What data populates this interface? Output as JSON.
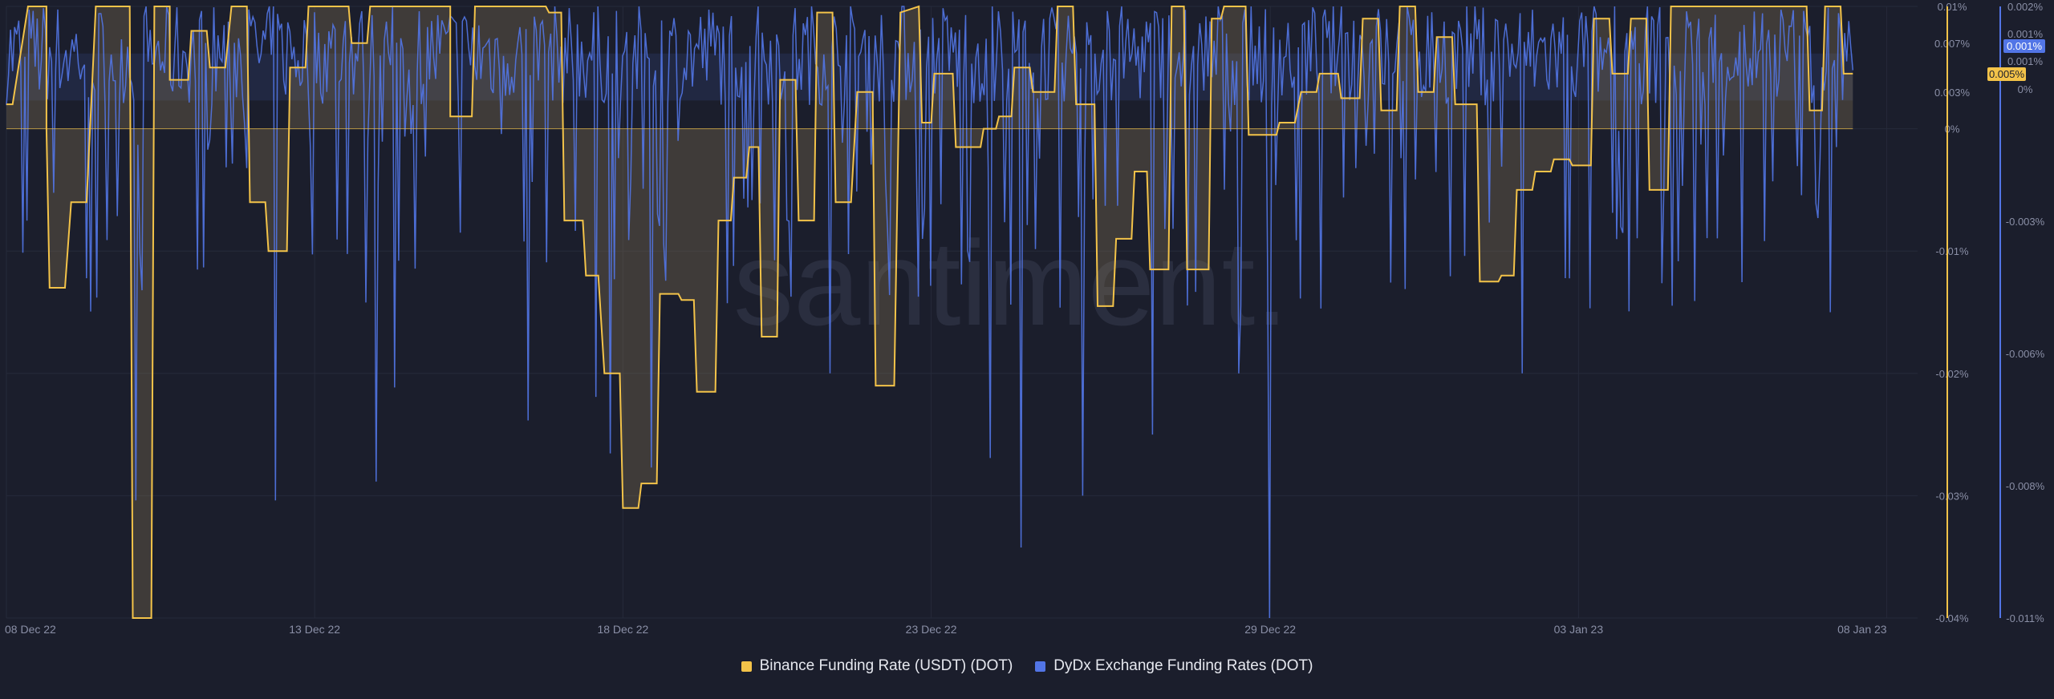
{
  "colors": {
    "background": "#1b1e2c",
    "grid": "#262a3a",
    "binance": "#f3c349",
    "dydx": "#5275e6",
    "text": "#8a8fa6",
    "watermark": "#2a2e3f"
  },
  "watermark": "santiment.",
  "legend": {
    "binance": "Binance Funding Rate (USDT) (DOT)",
    "dydx": "DyDx Exchange Funding Rates (DOT)"
  },
  "badges": {
    "binance": "0.005%",
    "dydx": "0.001%"
  },
  "chart_data": {
    "type": "line",
    "x_range": [
      "2022-12-08",
      "2023-01-08"
    ],
    "x_ticks": [
      "08 Dec 22",
      "13 Dec 22",
      "18 Dec 22",
      "23 Dec 22",
      "29 Dec 22",
      "03 Jan 23",
      "08 Jan 23"
    ],
    "x_tick_days": [
      0,
      5,
      10,
      15,
      20.5,
      25.5,
      30.5
    ],
    "left_axis": {
      "series": "Binance Funding Rate (USDT) (DOT)",
      "ylim": [
        -0.04,
        0.01
      ],
      "ticks": [
        0.01,
        0.007,
        0.005,
        0.003,
        0,
        -0.01,
        -0.02,
        -0.03,
        -0.04
      ],
      "tick_labels": [
        "0.01%",
        "0.007%",
        "0.005%",
        "0.003%",
        "0%",
        "-0.01%",
        "-0.02%",
        "-0.03%",
        "-0.04%"
      ]
    },
    "right_axis": {
      "series": "DyDx Exchange Funding Rates (DOT)",
      "ylim": [
        -0.011,
        0.002
      ],
      "ticks": [
        0.002,
        0.001,
        0.001,
        0,
        -0.003,
        -0.006,
        -0.008,
        -0.011
      ],
      "tick_labels": [
        "0.002%",
        "0.001%",
        "0.001%",
        "0%",
        "-0.003%",
        "-0.006%",
        "-0.008%",
        "-0.011%"
      ]
    },
    "series": [
      {
        "name": "Binance Funding Rate (USDT) (DOT)",
        "axis": "left",
        "style": "step-area",
        "points": [
          [
            0.0,
            0.002
          ],
          [
            0.1,
            0.002
          ],
          [
            0.35,
            0.01
          ],
          [
            0.65,
            0.01
          ],
          [
            0.65,
            0.0
          ],
          [
            0.7,
            -0.013
          ],
          [
            0.95,
            -0.013
          ],
          [
            1.05,
            -0.006
          ],
          [
            1.3,
            -0.006
          ],
          [
            1.45,
            0.01
          ],
          [
            2.0,
            0.01
          ],
          [
            2.05,
            -0.04
          ],
          [
            2.35,
            -0.04
          ],
          [
            2.4,
            0.01
          ],
          [
            2.65,
            0.01
          ],
          [
            2.65,
            0.004
          ],
          [
            2.95,
            0.004
          ],
          [
            3.0,
            0.008
          ],
          [
            3.25,
            0.008
          ],
          [
            3.3,
            0.005
          ],
          [
            3.55,
            0.005
          ],
          [
            3.65,
            0.01
          ],
          [
            3.9,
            0.01
          ],
          [
            3.95,
            -0.006
          ],
          [
            4.2,
            -0.006
          ],
          [
            4.25,
            -0.01
          ],
          [
            4.55,
            -0.01
          ],
          [
            4.6,
            0.005
          ],
          [
            4.85,
            0.005
          ],
          [
            4.9,
            0.01
          ],
          [
            5.55,
            0.01
          ],
          [
            5.6,
            0.007
          ],
          [
            5.85,
            0.007
          ],
          [
            5.9,
            0.01
          ],
          [
            7.2,
            0.01
          ],
          [
            7.2,
            0.001
          ],
          [
            7.55,
            0.001
          ],
          [
            7.6,
            0.01
          ],
          [
            8.75,
            0.01
          ],
          [
            8.8,
            0.0095
          ],
          [
            9.0,
            0.0095
          ],
          [
            9.05,
            -0.0075
          ],
          [
            9.35,
            -0.0075
          ],
          [
            9.4,
            -0.012
          ],
          [
            9.6,
            -0.012
          ],
          [
            9.7,
            -0.02
          ],
          [
            9.95,
            -0.02
          ],
          [
            10.0,
            -0.031
          ],
          [
            10.25,
            -0.031
          ],
          [
            10.3,
            -0.029
          ],
          [
            10.55,
            -0.029
          ],
          [
            10.6,
            -0.0135
          ],
          [
            10.9,
            -0.0135
          ],
          [
            10.95,
            -0.014
          ],
          [
            11.15,
            -0.014
          ],
          [
            11.2,
            -0.0215
          ],
          [
            11.5,
            -0.0215
          ],
          [
            11.55,
            -0.0075
          ],
          [
            11.75,
            -0.0075
          ],
          [
            11.8,
            -0.004
          ],
          [
            12.0,
            -0.004
          ],
          [
            12.05,
            -0.0015
          ],
          [
            12.2,
            -0.0015
          ],
          [
            12.25,
            -0.017
          ],
          [
            12.5,
            -0.017
          ],
          [
            12.55,
            0.004
          ],
          [
            12.8,
            0.004
          ],
          [
            12.85,
            -0.0075
          ],
          [
            13.1,
            -0.0075
          ],
          [
            13.15,
            0.0095
          ],
          [
            13.4,
            0.0095
          ],
          [
            13.45,
            -0.006
          ],
          [
            13.7,
            -0.006
          ],
          [
            13.8,
            0.003
          ],
          [
            14.05,
            0.003
          ],
          [
            14.1,
            -0.021
          ],
          [
            14.4,
            -0.021
          ],
          [
            14.5,
            0.0095
          ],
          [
            14.8,
            0.01
          ],
          [
            14.85,
            0.0005
          ],
          [
            15.0,
            0.0005
          ],
          [
            15.05,
            0.0045
          ],
          [
            15.35,
            0.0045
          ],
          [
            15.4,
            -0.0015
          ],
          [
            15.8,
            -0.0015
          ],
          [
            15.85,
            0.0
          ],
          [
            16.05,
            0.0
          ],
          [
            16.1,
            0.001
          ],
          [
            16.3,
            0.001
          ],
          [
            16.35,
            0.005
          ],
          [
            16.6,
            0.005
          ],
          [
            16.65,
            0.003
          ],
          [
            17.0,
            0.003
          ],
          [
            17.05,
            0.01
          ],
          [
            17.3,
            0.01
          ],
          [
            17.35,
            0.002
          ],
          [
            17.65,
            0.002
          ],
          [
            17.7,
            -0.0145
          ],
          [
            17.95,
            -0.0145
          ],
          [
            18.0,
            -0.009
          ],
          [
            18.25,
            -0.009
          ],
          [
            18.3,
            -0.0035
          ],
          [
            18.5,
            -0.0035
          ],
          [
            18.55,
            -0.0115
          ],
          [
            18.85,
            -0.0115
          ],
          [
            18.9,
            0.01
          ],
          [
            19.1,
            0.01
          ],
          [
            19.15,
            -0.0115
          ],
          [
            19.5,
            -0.0115
          ],
          [
            19.55,
            0.009
          ],
          [
            19.7,
            0.009
          ],
          [
            19.75,
            0.01
          ],
          [
            20.1,
            0.01
          ],
          [
            20.15,
            -0.0005
          ],
          [
            20.6,
            -0.0005
          ],
          [
            20.65,
            0.0005
          ],
          [
            20.9,
            0.0005
          ],
          [
            21.0,
            0.003
          ],
          [
            21.25,
            0.003
          ],
          [
            21.3,
            0.0045
          ],
          [
            21.6,
            0.0045
          ],
          [
            21.65,
            0.0025
          ],
          [
            21.95,
            0.0025
          ],
          [
            22.0,
            0.009
          ],
          [
            22.25,
            0.009
          ],
          [
            22.3,
            0.0015
          ],
          [
            22.55,
            0.0015
          ],
          [
            22.6,
            0.01
          ],
          [
            22.85,
            0.01
          ],
          [
            22.9,
            0.003
          ],
          [
            23.15,
            0.003
          ],
          [
            23.2,
            0.0075
          ],
          [
            23.45,
            0.0075
          ],
          [
            23.5,
            0.002
          ],
          [
            23.85,
            0.002
          ],
          [
            23.9,
            -0.0125
          ],
          [
            24.2,
            -0.0125
          ],
          [
            24.25,
            -0.012
          ],
          [
            24.45,
            -0.012
          ],
          [
            24.5,
            -0.005
          ],
          [
            24.75,
            -0.005
          ],
          [
            24.8,
            -0.0035
          ],
          [
            25.05,
            -0.0035
          ],
          [
            25.1,
            -0.0025
          ],
          [
            25.35,
            -0.0025
          ],
          [
            25.4,
            -0.003
          ],
          [
            25.7,
            -0.003
          ],
          [
            25.75,
            0.009
          ],
          [
            26.0,
            0.009
          ],
          [
            26.05,
            0.0045
          ],
          [
            26.3,
            0.0045
          ],
          [
            26.35,
            0.009
          ],
          [
            26.6,
            0.009
          ],
          [
            26.65,
            -0.005
          ],
          [
            26.95,
            -0.005
          ],
          [
            27.0,
            0.01
          ],
          [
            29.2,
            0.01
          ],
          [
            29.25,
            0.0015
          ],
          [
            29.45,
            0.0015
          ],
          [
            29.5,
            0.01
          ],
          [
            29.75,
            0.01
          ],
          [
            29.8,
            0.0045
          ],
          [
            29.95,
            0.0045
          ]
        ]
      },
      {
        "name": "DyDx Exchange Funding Rates (DOT)",
        "axis": "right",
        "style": "line",
        "note": "high-frequency series; values deterministically generated within observed envelope",
        "sample_count": 900,
        "baseline": 0.001,
        "envelope": [
          -0.011,
          0.002
        ],
        "spikes": [
          [
            2.1,
            -0.0085
          ],
          [
            4.35,
            -0.0085
          ],
          [
            6.0,
            -0.0081
          ],
          [
            6.3,
            -0.0061
          ],
          [
            8.45,
            -0.0068
          ],
          [
            9.55,
            -0.0063
          ],
          [
            9.8,
            -0.0075
          ],
          [
            10.45,
            -0.0078
          ],
          [
            13.35,
            -0.0058
          ],
          [
            15.95,
            -0.0076
          ],
          [
            16.45,
            -0.0095
          ],
          [
            17.45,
            -0.0084
          ],
          [
            18.6,
            -0.0071
          ],
          [
            20.0,
            -0.0058
          ],
          [
            20.5,
            -0.011
          ],
          [
            24.6,
            -0.0058
          ],
          [
            29.6,
            -0.0045
          ]
        ]
      }
    ]
  }
}
